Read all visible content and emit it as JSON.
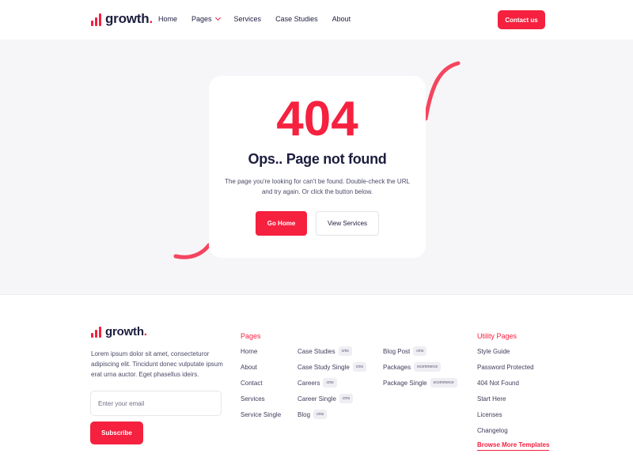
{
  "brand": {
    "name": "growth",
    "dot": ".",
    "accent": "#f5213f",
    "dark": "#1d1d3f"
  },
  "nav": {
    "items": [
      "Home",
      "Pages",
      "Services",
      "Case Studies",
      "About"
    ],
    "contact_label": "Contact us"
  },
  "hero": {
    "code": "404",
    "title": "Ops.. Page not found",
    "description": "The page you're looking for can't be found. Double-check the URL and try again. Or click the button below.",
    "primary_button": "Go Home",
    "secondary_button": "View Services"
  },
  "footer": {
    "about": "Lorem ipsum dolor sit amet, consecteturor adipiscing elit. Tincidunt donec vulputate ipsum erat urna auctor. Eget phasellus ideirs.",
    "email_placeholder": "Enter your email",
    "subscribe_label": "Subscribe",
    "pages_heading": "Pages",
    "pages_col1": [
      "Home",
      "About",
      "Contact",
      "Services",
      "Service Single"
    ],
    "pages_col2": [
      {
        "label": "Case Studies",
        "tag": "cms"
      },
      {
        "label": "Case Study Single",
        "tag": "cms"
      },
      {
        "label": "Careers",
        "tag": "cms"
      },
      {
        "label": "Career Single",
        "tag": "cms"
      },
      {
        "label": "Blog",
        "tag": "cms"
      }
    ],
    "pages_col3": [
      {
        "label": "Blog Post",
        "tag": "cms"
      },
      {
        "label": "Packages",
        "tag": "ecommerce"
      },
      {
        "label": "Package Single",
        "tag": "ecommerce"
      }
    ],
    "utility_heading": "Utility Pages",
    "utility": [
      "Style Guide",
      "Password Protected",
      "404 Not Found",
      "Start Here",
      "Licenses",
      "Changelog"
    ],
    "browse_label": "Browse More Templates"
  }
}
